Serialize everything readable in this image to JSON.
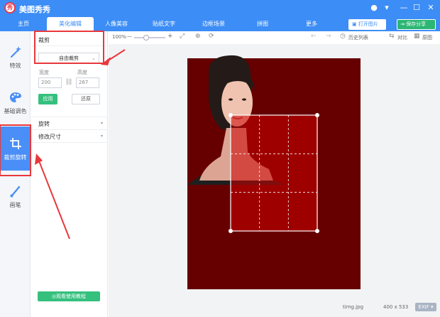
{
  "app": {
    "title": "美图秀秀",
    "logo_char": "秀"
  },
  "window_controls": {
    "chat": "●",
    "dropdown": "▾",
    "minimize": "—",
    "maximize": "☐",
    "close": "✕"
  },
  "tabs": [
    {
      "label": "主页",
      "active": false
    },
    {
      "label": "美化编辑",
      "active": true
    },
    {
      "label": "人像美容",
      "active": false
    },
    {
      "label": "贴纸文字",
      "active": false
    },
    {
      "label": "边框场景",
      "active": false
    },
    {
      "label": "拼图",
      "active": false
    },
    {
      "label": "更多",
      "active": false
    }
  ],
  "top_buttons": {
    "open": "打开图片",
    "save": "保存分享"
  },
  "left_nav": [
    {
      "label": "特效",
      "icon": "magic-wand-icon",
      "active": false
    },
    {
      "label": "基础调色",
      "icon": "palette-icon",
      "active": false
    },
    {
      "label": "裁剪旋转",
      "icon": "crop-icon",
      "active": true
    },
    {
      "label": "画笔",
      "icon": "brush-icon",
      "active": false
    }
  ],
  "panel": {
    "crop_title": "裁剪",
    "crop_mode": "自由裁剪",
    "width_label": "宽度",
    "height_label": "高度",
    "width_value": "200",
    "height_value": "267",
    "apply": "应用",
    "reset": "还原",
    "rotate": "旋转",
    "resize": "修改尺寸",
    "tutorial": "观看使用教程"
  },
  "toolbar": {
    "zoom": "100%",
    "minus": "—",
    "plus": "+",
    "history": "历史列表",
    "compare": "对比",
    "original": "原图"
  },
  "status": {
    "filename": "timg.jpg",
    "dimensions": "400 x 533",
    "exif": "EXIF"
  },
  "colors": {
    "accent": "#3c8df6",
    "panel_active": "#4a8ff7",
    "apply_green": "#35c07e",
    "save_green": "#2bb673",
    "annotation_red": "#e8383c",
    "image_bg": "#660000",
    "crop_fill": "#cc0000"
  }
}
